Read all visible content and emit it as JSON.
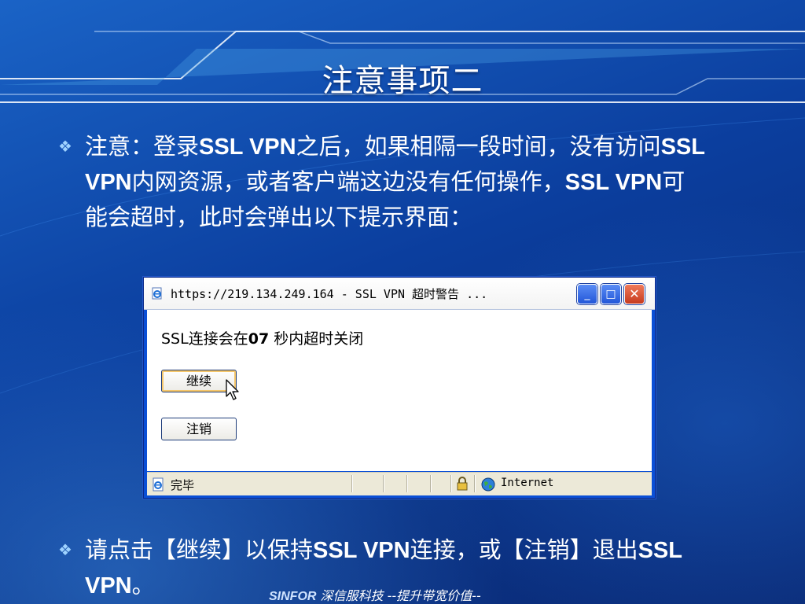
{
  "slide": {
    "title": "注意事项二",
    "bullet1": {
      "p1": "注意：登录",
      "b1": "SSL VPN",
      "p2": "之后，如果相隔一段时间，没有访问",
      "b2": "SSL VPN",
      "p3": "内网资源，或者客户端这边没有任何操作，",
      "b3": "SSL VPN",
      "p4": "可能会超时，此时会弹出以下提示界面："
    },
    "bullet2": {
      "p1": "请点击【继续】以保持",
      "b1": "SSL VPN",
      "p2": "连接，或【注销】退出",
      "b2": "SSL VPN",
      "p3": "。"
    },
    "footer": {
      "brand": "SINFOR",
      "text": " 深信服科技  --提升带宽价值--"
    }
  },
  "dialog": {
    "title": "https://219.134.249.164 - SSL VPN 超时警告 ...",
    "message_prefix": "SSL连接会在",
    "countdown": "07",
    "message_suffix": " 秒内超时关闭",
    "continue_label": "继续",
    "logout_label": "注销",
    "status_text": "完毕",
    "zone_text": "Internet",
    "controls": {
      "minimize": "_",
      "maximize": "□",
      "close": "✕"
    }
  },
  "icons": {
    "window_icon": "ie-page-icon",
    "status_icon": "ie-page-icon",
    "lock_icon": "padlock-icon",
    "zone_icon": "internet-globe-icon",
    "bullet_icon": "diamond-bullet-icon"
  },
  "colors": {
    "background": "#0b3e9e",
    "titlebar_blue": "#2256d8",
    "close_red": "#c63a1e",
    "bullet_mark": "#9fd3ff"
  }
}
